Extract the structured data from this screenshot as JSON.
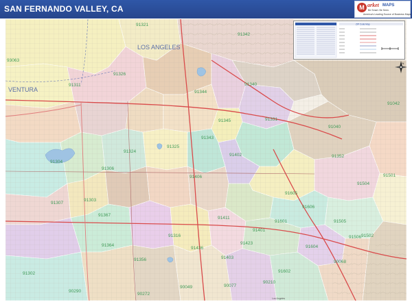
{
  "header": {
    "title": "SAN FERNANDO VALLEY, CA"
  },
  "logo": {
    "mark": "M",
    "brand_a": "arket",
    "brand_b": "MAPS",
    "slogan": "Be Smart. Be Seen.",
    "tagline": "America's Leading Source of Business Maps"
  },
  "map": {
    "cities": [
      "LOS ANGELES",
      "VENTURA"
    ],
    "zip_labels": [
      "91321",
      "91342",
      "93063",
      "91326",
      "91311",
      "91344",
      "91340",
      "91042",
      "91345",
      "91331",
      "91040",
      "91324",
      "91343",
      "91325",
      "91402",
      "91352",
      "91304",
      "91306",
      "91406",
      "91501",
      "91504",
      "91307",
      "91303",
      "91605",
      "91606",
      "91367",
      "91411",
      "91401",
      "91601",
      "91505",
      "91502",
      "91364",
      "91316",
      "91436",
      "91423",
      "91604",
      "91506",
      "91356",
      "91403",
      "91602",
      "91302",
      "90290",
      "90049",
      "90077",
      "90210",
      "90068",
      "90272"
    ],
    "legend_heading": "ZIP Code Map",
    "compass_label": "N",
    "bottom_place": "Los Angeles"
  }
}
